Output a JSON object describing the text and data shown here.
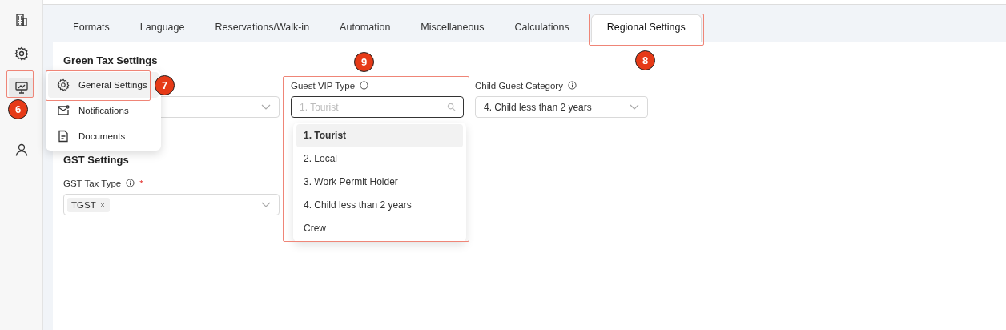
{
  "sidebar": {
    "items": [
      {
        "selected": false
      },
      {
        "selected": false
      },
      {
        "selected": true
      },
      {
        "selected": false
      }
    ]
  },
  "tabs": [
    {
      "label": "Formats",
      "selected": false
    },
    {
      "label": "Language",
      "selected": false
    },
    {
      "label": "Reservations/Walk-in",
      "selected": false
    },
    {
      "label": "Automation",
      "selected": false
    },
    {
      "label": "Miscellaneous",
      "selected": false
    },
    {
      "label": "Calculations",
      "selected": false
    },
    {
      "label": "Regional Settings",
      "selected": true
    }
  ],
  "green_tax": {
    "title": "Green Tax Settings",
    "guest_vip_type": {
      "label": "Guest VIP Type",
      "placeholder": "1. Tourist"
    },
    "child_guest_category": {
      "label": "Child Guest Category",
      "value": "4. Child less than 2 years"
    }
  },
  "gst": {
    "title": "GST Settings",
    "tax_type": {
      "label": "GST Tax Type",
      "required_mark": "*",
      "tags": [
        "TGST"
      ]
    }
  },
  "dropdown": {
    "options": [
      {
        "label": "1. Tourist",
        "selected": true
      },
      {
        "label": "2. Local",
        "selected": false
      },
      {
        "label": "3. Work Permit Holder",
        "selected": false
      },
      {
        "label": "4. Child less than 2 years",
        "selected": false
      },
      {
        "label": "Crew",
        "selected": false
      }
    ]
  },
  "menu": {
    "items": [
      {
        "label": "General Settings",
        "selected": true
      },
      {
        "label": "Notifications",
        "selected": false
      },
      {
        "label": "Documents",
        "selected": false
      }
    ]
  },
  "annotations": [
    {
      "number": "6"
    },
    {
      "number": "7"
    },
    {
      "number": "8"
    },
    {
      "number": "9"
    }
  ]
}
